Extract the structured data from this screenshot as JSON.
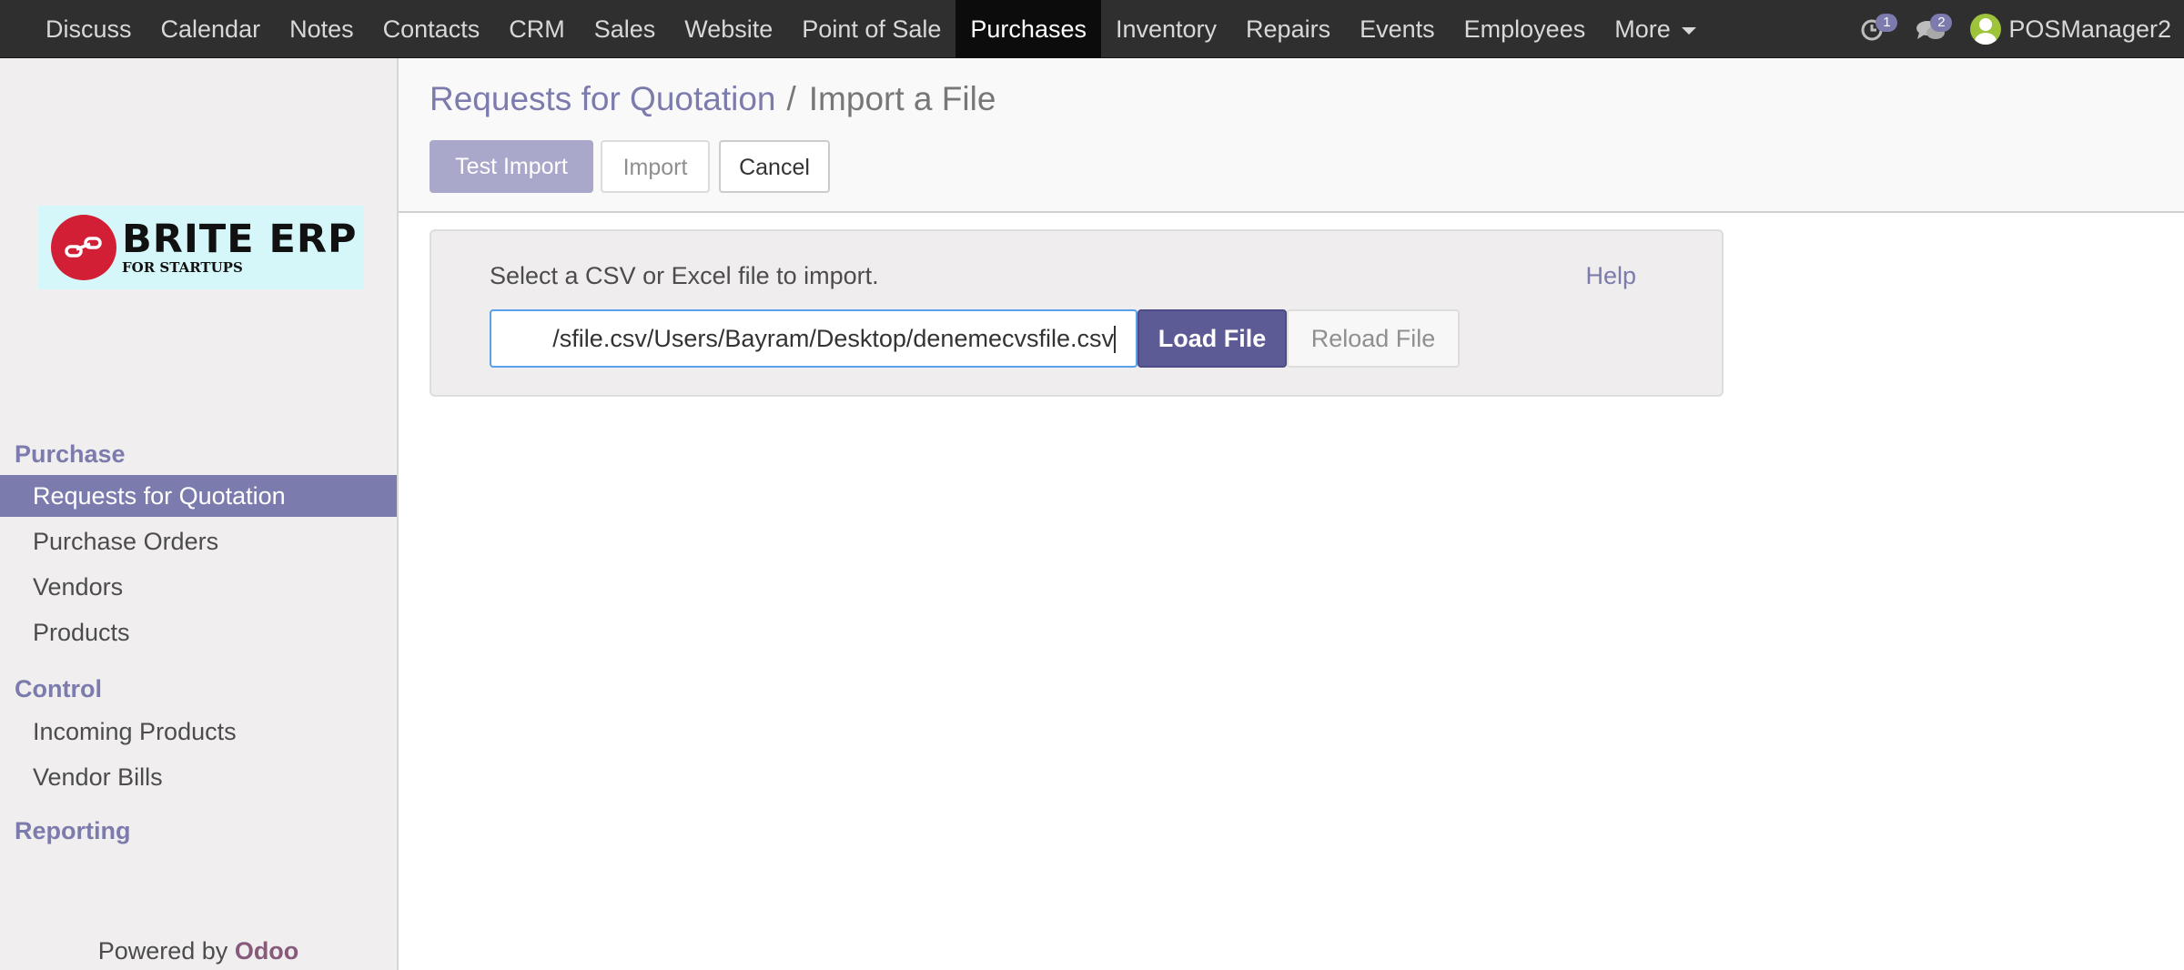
{
  "navbar": {
    "items": [
      "Discuss",
      "Calendar",
      "Notes",
      "Contacts",
      "CRM",
      "Sales",
      "Website",
      "Point of Sale",
      "Purchases",
      "Inventory",
      "Repairs",
      "Events",
      "Employees",
      "More"
    ],
    "active": "Purchases",
    "activities_count": "1",
    "messages_count": "2",
    "user_name": "POSManager2"
  },
  "sidebar": {
    "logo_main": "BRITE ERP",
    "logo_sub": "FOR STARTUPS",
    "sections": [
      {
        "title": "Purchase",
        "items": [
          "Requests for Quotation",
          "Purchase Orders",
          "Vendors",
          "Products"
        ]
      },
      {
        "title": "Control",
        "items": [
          "Incoming Products",
          "Vendor Bills"
        ]
      },
      {
        "title": "Reporting",
        "items": []
      }
    ],
    "active_item": "Requests for Quotation",
    "powered_by": "Powered by",
    "powered_brand": "Odoo"
  },
  "control_panel": {
    "breadcrumb_parent": "Requests for Quotation",
    "breadcrumb_separator": "/",
    "breadcrumb_current": "Import a File",
    "test_import_label": "Test Import",
    "import_label": "Import",
    "cancel_label": "Cancel"
  },
  "import_panel": {
    "instruction": "Select a CSV or Excel file to import.",
    "help_label": "Help",
    "file_input_value": "/sfile.csv/Users/Bayram/Desktop/denemecvsfile.csv",
    "load_file_label": "Load File",
    "reload_file_label": "Reload File"
  },
  "colors": {
    "navbar_bg": "#2f2f2f",
    "brand_purple": "#7c7bad",
    "load_button": "#5d5b96",
    "logo_red": "#d31f36",
    "logo_bg": "#d5f7fa"
  }
}
